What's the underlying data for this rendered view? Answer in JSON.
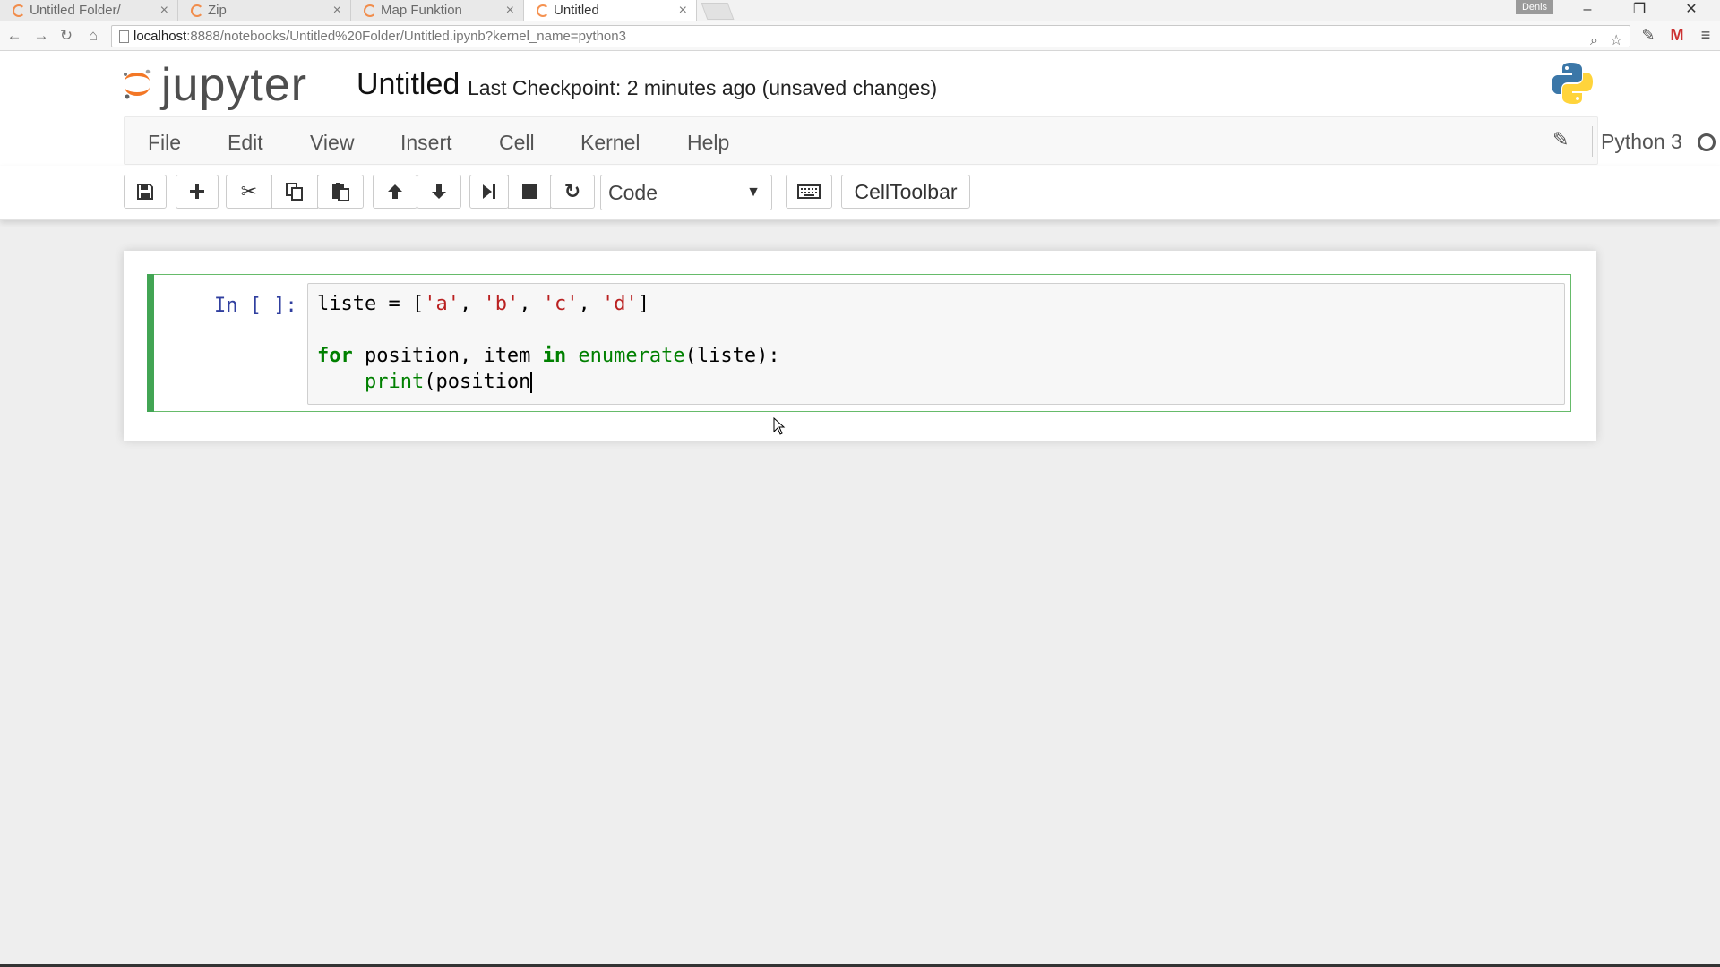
{
  "browser": {
    "tabs": [
      {
        "label": "Untitled Folder/",
        "active": false
      },
      {
        "label": "Zip",
        "active": false
      },
      {
        "label": "Map Funktion",
        "active": false
      },
      {
        "label": "Untitled",
        "active": true
      }
    ],
    "tab_close_glyph": "×",
    "user_badge": "Denis",
    "url_host": "localhost",
    "url_rest": ":8888/notebooks/Untitled%20Folder/Untitled.ipynb?kernel_name=python3"
  },
  "header": {
    "logo_text": "jupyter",
    "notebook_title": "Untitled",
    "checkpoint": "Last Checkpoint: 2 minutes ago (unsaved changes)"
  },
  "menu": {
    "items": [
      "File",
      "Edit",
      "View",
      "Insert",
      "Cell",
      "Kernel",
      "Help"
    ],
    "kernel_name": "Python 3"
  },
  "toolbar": {
    "cell_type": "Code",
    "celltoolbar_label": "CellToolbar",
    "icons": [
      "save-icon",
      "plus-icon",
      "cut-icon",
      "copy-icon",
      "paste-icon",
      "arrow-up-icon",
      "arrow-down-icon",
      "run-next-icon",
      "stop-icon",
      "restart-icon",
      "keyboard-icon"
    ]
  },
  "cell": {
    "prompt": "In [ ]:",
    "code": {
      "line1": {
        "var": "liste",
        "op": " = [",
        "s1": "'a'",
        "c1": ", ",
        "s2": "'b'",
        "c2": ", ",
        "s3": "'c'",
        "c3": ", ",
        "s4": "'d'",
        "end": "]"
      },
      "line3": {
        "kw1": "for",
        "t1": " position, item ",
        "kw2": "in",
        "t2": " ",
        "fn": "enumerate",
        "t3": "(liste):"
      },
      "line4": {
        "indent": "    ",
        "fn": "print",
        "t1": "(position"
      }
    }
  },
  "colors": {
    "jupyter_orange": "#f37726",
    "cell_border_green": "#66bb6a",
    "prompt_blue": "#303f9f",
    "keyword_green": "#008000",
    "string_red": "#ba2121"
  }
}
